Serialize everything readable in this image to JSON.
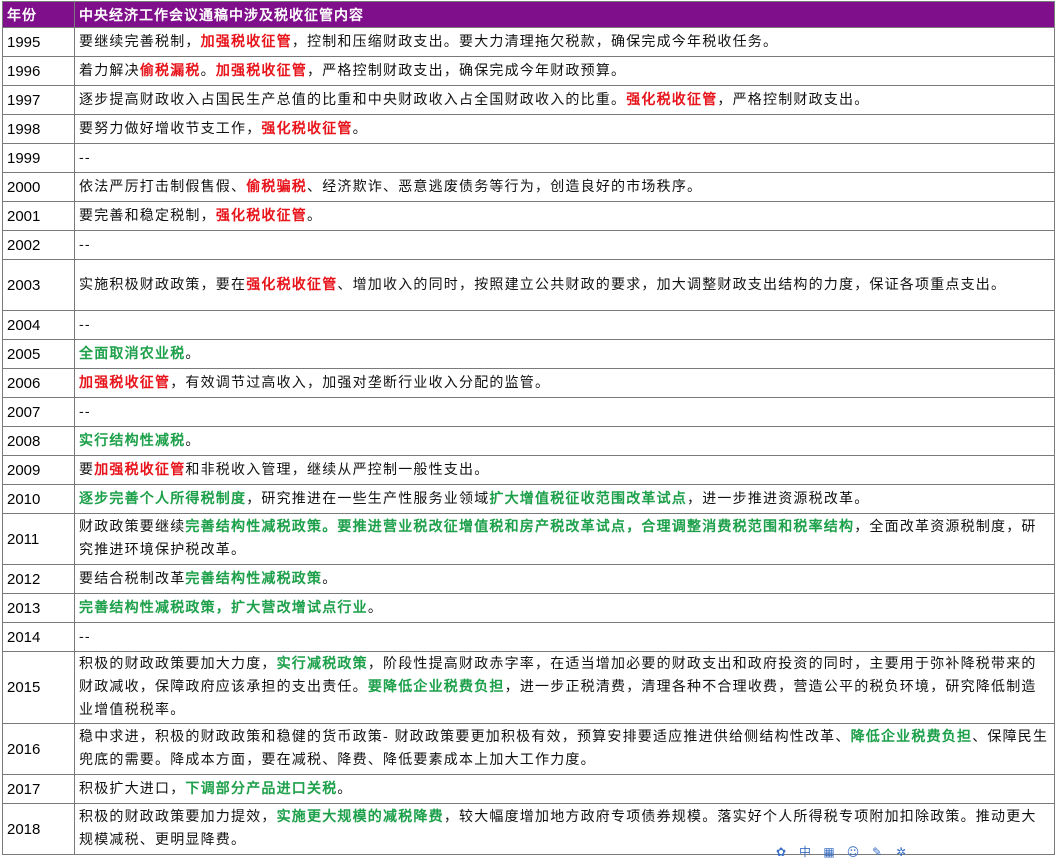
{
  "header": {
    "year_col": "年份",
    "content_col": "中央经济工作会议通稿中涉及税收征管内容"
  },
  "rows": [
    {
      "year": "1995",
      "size": 1,
      "segments": [
        {
          "t": "要继续完善税制，"
        },
        {
          "t": "加强税收征管",
          "c": "red"
        },
        {
          "t": "，控制和压缩财政支出。要大力清理拖欠税款，确保完成今年税收任务。"
        }
      ]
    },
    {
      "year": "1996",
      "size": 1,
      "segments": [
        {
          "t": "着力解决"
        },
        {
          "t": "偷税漏税",
          "c": "red"
        },
        {
          "t": "。"
        },
        {
          "t": "加强税收征管",
          "c": "red"
        },
        {
          "t": "，严格控制财政支出，确保完成今年财政预算。"
        }
      ]
    },
    {
      "year": "1997",
      "size": 1,
      "segments": [
        {
          "t": "逐步提高财政收入占国民生产总值的比重和中央财政收入占全国财政收入的比重。"
        },
        {
          "t": "强化税收征管",
          "c": "red"
        },
        {
          "t": "，严格控制财政支出。"
        }
      ]
    },
    {
      "year": "1998",
      "size": 1,
      "segments": [
        {
          "t": "要努力做好增收节支工作，"
        },
        {
          "t": "强化税收征管",
          "c": "red"
        },
        {
          "t": "。"
        }
      ]
    },
    {
      "year": "1999",
      "size": 1,
      "segments": [
        {
          "t": "--"
        }
      ]
    },
    {
      "year": "2000",
      "size": 1,
      "segments": [
        {
          "t": "依法严厉打击制假售假、"
        },
        {
          "t": "偷税骗税",
          "c": "red"
        },
        {
          "t": "、经济欺诈、恶意逃废债务等行为，创造良好的市场秩序。"
        }
      ]
    },
    {
      "year": "2001",
      "size": 1,
      "segments": [
        {
          "t": "要完善和稳定税制，"
        },
        {
          "t": "强化税收征管",
          "c": "red"
        },
        {
          "t": "。"
        }
      ]
    },
    {
      "year": "2002",
      "size": 1,
      "segments": [
        {
          "t": "--"
        }
      ]
    },
    {
      "year": "2003",
      "size": 2,
      "segments": [
        {
          "t": "实施积极财政政策，要在"
        },
        {
          "t": "强化税收征管",
          "c": "red"
        },
        {
          "t": "、增加收入的同时，按照建立公共财政的要求，加大调整财政支出结构的力度，保证各项重点支出。"
        }
      ]
    },
    {
      "year": "2004",
      "size": 1,
      "segments": [
        {
          "t": "--"
        }
      ]
    },
    {
      "year": "2005",
      "size": 1,
      "segments": [
        {
          "t": "全面取消农业税",
          "c": "green"
        },
        {
          "t": "。"
        }
      ]
    },
    {
      "year": "2006",
      "size": 1,
      "segments": [
        {
          "t": "加强税收征管",
          "c": "red"
        },
        {
          "t": "，有效调节过高收入，加强对垄断行业收入分配的监管。"
        }
      ]
    },
    {
      "year": "2007",
      "size": 1,
      "segments": [
        {
          "t": "--"
        }
      ]
    },
    {
      "year": "2008",
      "size": 1,
      "segments": [
        {
          "t": "实行结构性减税",
          "c": "green"
        },
        {
          "t": "。"
        }
      ]
    },
    {
      "year": "2009",
      "size": 1,
      "segments": [
        {
          "t": "要"
        },
        {
          "t": "加强税收征管",
          "c": "red"
        },
        {
          "t": "和非税收入管理，继续从严控制一般性支出。"
        }
      ]
    },
    {
      "year": "2010",
      "size": 1,
      "segments": [
        {
          "t": "逐步完善个人所得税制度",
          "c": "green"
        },
        {
          "t": "，研究推进在一些生产性服务业领域"
        },
        {
          "t": "扩大增值税征收范围改革试点",
          "c": "green"
        },
        {
          "t": "，进一步推进资源税改革。"
        }
      ]
    },
    {
      "year": "2011",
      "size": 2,
      "segments": [
        {
          "t": "财政政策要继续"
        },
        {
          "t": "完善结构性减税政策。要推进营业税改征增值税和房产税改革试点，合理调整消费税范围和税率结构",
          "c": "green"
        },
        {
          "t": "，全面改革资源税制度，研究推进环境保护税改革。"
        }
      ]
    },
    {
      "year": "2012",
      "size": 1,
      "segments": [
        {
          "t": "要结合税制改革"
        },
        {
          "t": "完善结构性减税政策",
          "c": "green"
        },
        {
          "t": "。"
        }
      ]
    },
    {
      "year": "2013",
      "size": 1,
      "segments": [
        {
          "t": "完善结构性减税政策，扩大营改增试点行业",
          "c": "green"
        },
        {
          "t": "。"
        }
      ]
    },
    {
      "year": "2014",
      "size": 1,
      "segments": [
        {
          "t": "--"
        }
      ]
    },
    {
      "year": "2015",
      "size": 3,
      "segments": [
        {
          "t": "积极的财政政策要加大力度，"
        },
        {
          "t": "实行减税政策",
          "c": "green"
        },
        {
          "t": "，阶段性提高财政赤字率，在适当增加必要的财政支出和政府投资的同时，主要用于弥补降税带来的财政减收，保障政府应该承担的支出责任。"
        },
        {
          "t": "要降低企业税费负担",
          "c": "green"
        },
        {
          "t": "，进一步正税清费，清理各种不合理收费，营造公平的税负环境，研究降低制造业增值税税率。"
        }
      ]
    },
    {
      "year": "2016",
      "size": 2,
      "segments": [
        {
          "t": "稳中求进，积极的财政政策和稳健的货币政策- 财政政策要更加积极有效，预算安排要适应推进供给侧结构性改革、"
        },
        {
          "t": "降低企业税费负担",
          "c": "green"
        },
        {
          "t": "、保障民生兜底的需要。降成本方面，要在减税、降费、降低要素成本上加大工作力度。"
        }
      ]
    },
    {
      "year": "2017",
      "size": 1,
      "segments": [
        {
          "t": "积极扩大进口，"
        },
        {
          "t": "下调部分产品进口关税",
          "c": "green"
        },
        {
          "t": "。"
        }
      ]
    },
    {
      "year": "2018",
      "size": 2,
      "segments": [
        {
          "t": "积极的财政政策要加力提效，"
        },
        {
          "t": "实施更大规模的减税降费",
          "c": "green"
        },
        {
          "t": "，较大幅度增加地方政府专项债券规模。落实好个人所得税专项附加扣除政策。推动更大规模减税、更明显降费。"
        }
      ]
    }
  ],
  "toolbar": [
    {
      "icon": "gear-icon",
      "glyph": "✿"
    },
    {
      "icon": "chinese-input-icon",
      "glyph": "中"
    },
    {
      "icon": "keyboard-icon",
      "glyph": "▦"
    },
    {
      "icon": "smiley-icon",
      "glyph": "☺"
    },
    {
      "icon": "pen-icon",
      "glyph": "✎"
    },
    {
      "icon": "settings-icon",
      "glyph": "✲"
    }
  ]
}
